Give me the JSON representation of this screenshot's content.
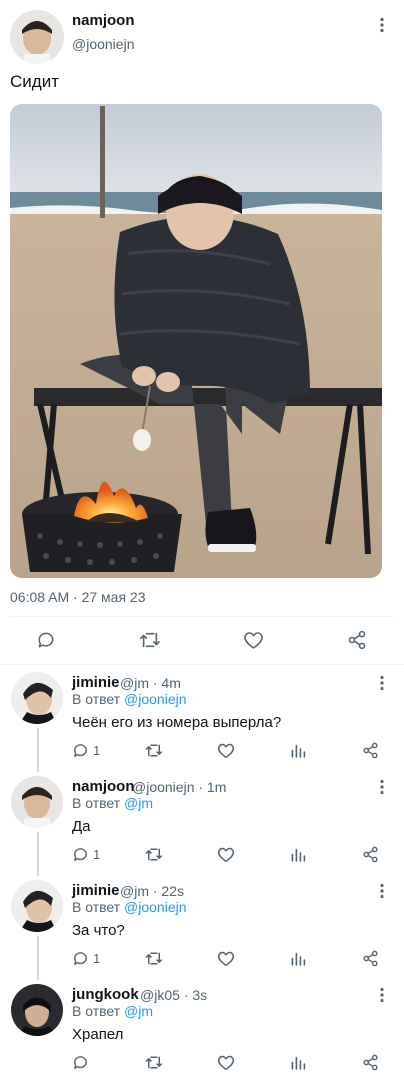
{
  "main_tweet": {
    "author_name": "namjoon",
    "author_handle": "@jooniejn",
    "text": "Сидит",
    "timestamp": "06:08 AM · 27 мая 23"
  },
  "replies": [
    {
      "name": "jiminie",
      "meta": "@jm · 4m",
      "reply_prefix": "В ответ",
      "reply_to": "@jooniejn",
      "text": "Чеён его из номера выперла?",
      "reply_count": "1"
    },
    {
      "name": "namjoon",
      "meta": "@jooniejn · 1m",
      "reply_prefix": "В ответ",
      "reply_to": "@jm",
      "text": "Да",
      "reply_count": "1"
    },
    {
      "name": "jiminie",
      "meta": "@jm · 22s",
      "reply_prefix": "В ответ",
      "reply_to": "@jooniejn",
      "text": "За что?",
      "reply_count": "1"
    },
    {
      "name": "jungkook",
      "meta": "@jk05 · 3s",
      "reply_prefix": "В ответ",
      "reply_to": "@jm",
      "text": "Храпел",
      "reply_count": ""
    }
  ],
  "icons": {
    "reply": "speech-bubble-icon",
    "retweet": "retweet-icon",
    "like": "heart-icon",
    "views": "bar-chart-icon",
    "share": "share-icon",
    "more": "more-vertical-icon"
  },
  "colors": {
    "accent": "#1d9bf0",
    "muted": "#536471",
    "divider": "#eff3f4"
  }
}
